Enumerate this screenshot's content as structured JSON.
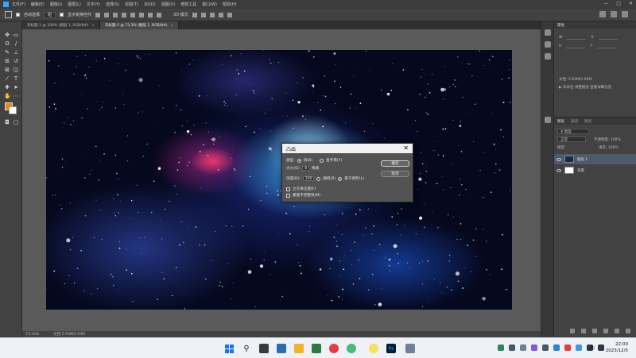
{
  "app": {
    "menu": [
      "文件(F)",
      "编辑(E)",
      "图像(I)",
      "图层(L)",
      "文字(Y)",
      "选择(S)",
      "滤镜(T)",
      "3D(D)",
      "视图(V)",
      "增效工具",
      "窗口(W)",
      "帮助(H)"
    ]
  },
  "options": {
    "auto_select_label": "自动选择",
    "layer_select": "组",
    "transform_label": "显示变换控件",
    "mode_3d": "3D 模式"
  },
  "tabs": [
    {
      "label": "未标题-1 @ 100% (图层 1, RGB/8#)",
      "active": false
    },
    {
      "label": "未标题-2 @ 73.3% (图层 1, RGB/8#)",
      "active": true
    }
  ],
  "status": {
    "zoom": "73.33%",
    "doc_size": "文档:5.93M/5.93M"
  },
  "right_panel": {
    "props_tabs": [
      "属性"
    ],
    "props_rows": [
      "W",
      "X",
      "H",
      "Y"
    ],
    "doc_info": "文档: 5.93M/5.93M",
    "tools_note": "▶ 未命名 调整图层 查看详细信息",
    "layer_tabs": [
      "图层",
      "通道",
      "路径"
    ],
    "kind_select": "♀ 类型",
    "blend_mode": "正常",
    "opacity_label": "不透明度: 100%",
    "lock_label": "锁定:",
    "fill_label": "填充: 100%",
    "layers": [
      {
        "name": "图层 1",
        "selected": true
      },
      {
        "name": "背景",
        "selected": false
      }
    ]
  },
  "dialog": {
    "title": "凸出",
    "type_label": "类型:",
    "type_block": "块(B)",
    "type_pyramid": "金字塔(Y)",
    "size_label": "大小(S):",
    "size_value": "8",
    "size_unit": "像素",
    "depth_label": "深度(D):",
    "depth_value": "100",
    "depth_random": "随机(R)",
    "depth_level": "基于色阶(L)",
    "solid_front": "立方体正面(F)",
    "mask_incomplete": "蒙版不完整块(M)",
    "ok": "确定",
    "cancel": "取消"
  },
  "taskbar": {
    "time": "22:00",
    "date": "2023/12/5",
    "lang": "中",
    "colors": {
      "start": "#1a73e8",
      "accent_ps": "#31a8ff"
    }
  },
  "toolbar": {
    "foreground_color": "#e8891c",
    "background_color": "#ffffff"
  }
}
